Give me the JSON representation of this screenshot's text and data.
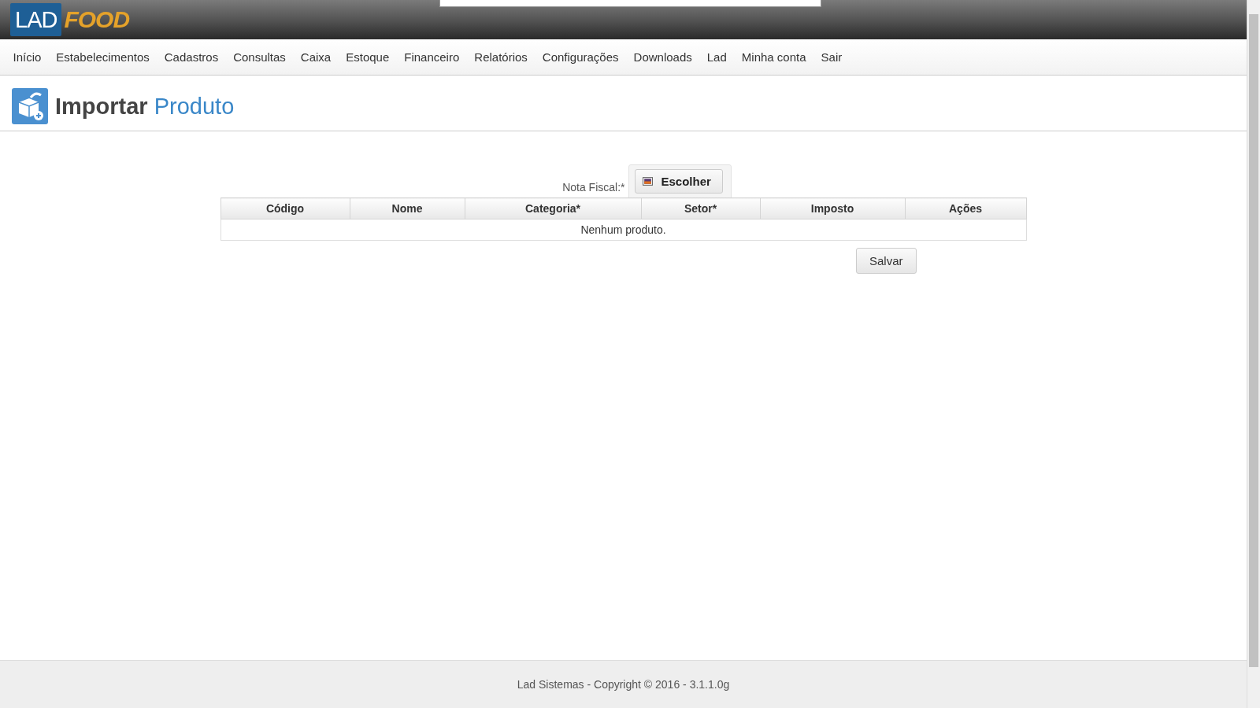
{
  "logo": {
    "boxed": "LAD",
    "text": "FOOD"
  },
  "nav": [
    "Início",
    "Estabelecimentos",
    "Cadastros",
    "Consultas",
    "Caixa",
    "Estoque",
    "Financeiro",
    "Relatórios",
    "Configurações",
    "Downloads",
    "Lad",
    "Minha conta",
    "Sair"
  ],
  "page_title": {
    "main": "Importar",
    "accent": "Produto"
  },
  "form": {
    "label": "Nota Fiscal:*",
    "file_button": "Escolher"
  },
  "table": {
    "columns": [
      "Código",
      "Nome",
      "Categoria*",
      "Setor*",
      "Imposto",
      "Ações"
    ],
    "empty_message": "Nenhum produto."
  },
  "save_button": "Salvar",
  "footer": "Lad Sistemas - Copyright © 2016 - 3.1.1.0g"
}
